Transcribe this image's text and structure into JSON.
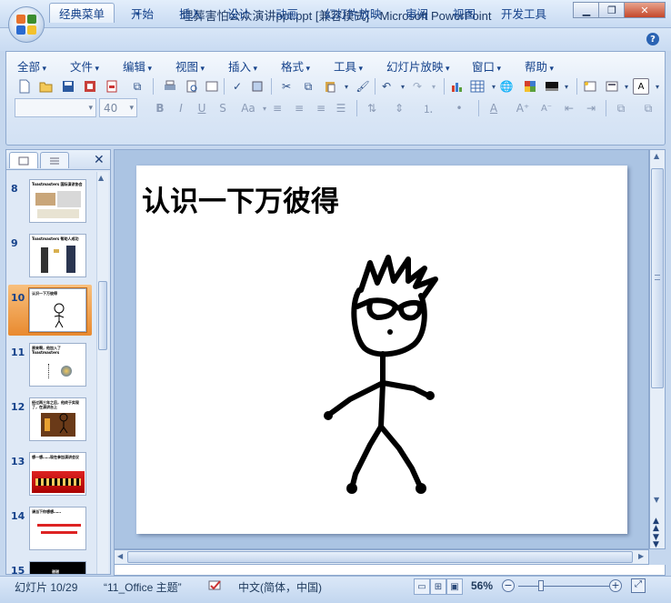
{
  "window": {
    "title": "埋葬害怕公众演讲ppt.ppt [兼容模式] - Microsoft PowerPoint",
    "minimize_icon": "minimize-icon",
    "maximize_icon": "restore-icon",
    "close_icon": "close-icon"
  },
  "quick_access": [
    "save-icon",
    "undo-icon",
    "redo-icon",
    "customize-icon"
  ],
  "tabs": [
    {
      "label": "经典菜单",
      "active": true
    },
    {
      "label": "开始"
    },
    {
      "label": "插入"
    },
    {
      "label": "设计"
    },
    {
      "label": "动画"
    },
    {
      "label": "幻灯片放映"
    },
    {
      "label": "审阅"
    },
    {
      "label": "视图"
    },
    {
      "label": "开发工具"
    }
  ],
  "menu": [
    "全部",
    "文件",
    "编辑",
    "视图",
    "插入",
    "格式",
    "工具",
    "幻灯片放映",
    "窗口",
    "帮助"
  ],
  "font": {
    "name": "",
    "size": "40"
  },
  "slides": [
    {
      "num": "8",
      "title": "Toastmasters 国际演讲协会"
    },
    {
      "num": "9",
      "title": "Toastmasters 帮助人成功"
    },
    {
      "num": "10",
      "title": "认识一下万彼得",
      "selected": true
    },
    {
      "num": "11",
      "title": "原来啊，他加入了 Toastmasters"
    },
    {
      "num": "12",
      "title": "经过两三年之后，他终于实现了，在演讲台上"
    },
    {
      "num": "13",
      "title": "想一想……现在参加演讲会议"
    },
    {
      "num": "14",
      "title": "请当下你想想……"
    },
    {
      "num": "15",
      "title": "谢谢"
    }
  ],
  "current_slide": {
    "title": "认识一下万彼得"
  },
  "status": {
    "slide_info": "幻灯片 10/29",
    "theme": "“11_Office 主题”",
    "language": "中文(简体，中国)",
    "zoom": "56%"
  },
  "colors": {
    "accent": "#15428b",
    "ribbon": "#dbe7f6",
    "selection": "#f3a05a"
  }
}
